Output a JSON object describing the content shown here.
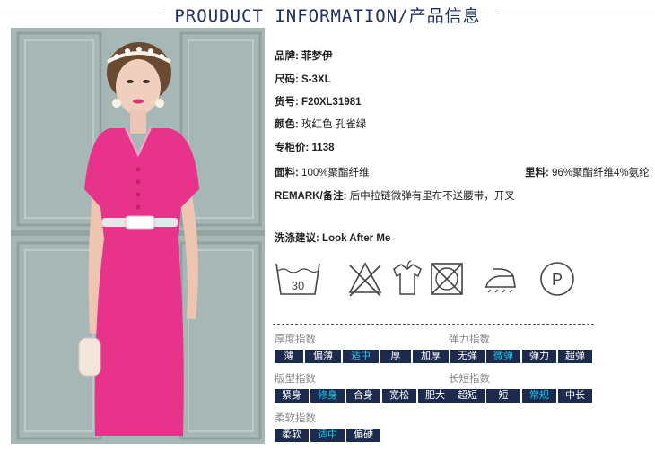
{
  "header": {
    "title": "PROUDUCT INFORMATION/产品信息"
  },
  "info": {
    "brand": {
      "label": "品牌:",
      "value": "菲梦伊"
    },
    "size": {
      "label": "尺码:",
      "value": "S-3XL"
    },
    "sku": {
      "label": "货号:",
      "value": "F20XL31981"
    },
    "color": {
      "label": "颜色:",
      "value": "玫红色 孔雀绿"
    },
    "price": {
      "label": "专柜价:",
      "value": "1138"
    },
    "fabric": {
      "label": "面料:",
      "value": "100%聚酯纤维"
    },
    "lining": {
      "label": "里料:",
      "value": "96%聚酯纤维4%氨纶"
    },
    "remark": {
      "label": "REMARK/备注:",
      "value": "后中拉链微弹有里布不送腰带，开叉"
    },
    "wash": {
      "label": "洗涤建议:",
      "value": "Look After Me"
    }
  },
  "care_icons": [
    {
      "icon": "wash-30-icon",
      "text": "30"
    },
    {
      "icon": "no-bleach-icon"
    },
    {
      "icon": "hang-dry-icon"
    },
    {
      "icon": "no-tumble-dry-icon"
    },
    {
      "icon": "iron-icon"
    },
    {
      "icon": "dry-clean-p-icon",
      "text": "P"
    }
  ],
  "indices": {
    "thickness": {
      "label": "厚度指数",
      "options": [
        "薄",
        "偏薄",
        "适中",
        "厚",
        "加厚"
      ],
      "selected": "适中"
    },
    "elasticity": {
      "label": "弹力指数",
      "options": [
        "无弹",
        "微弹",
        "弹力",
        "超弹"
      ],
      "selected": "微弹"
    },
    "fit": {
      "label": "版型指数",
      "options": [
        "紧身",
        "修身",
        "合身",
        "宽松",
        "肥大"
      ],
      "selected": "修身"
    },
    "length": {
      "label": "长短指数",
      "options": [
        "超短",
        "短",
        "常规",
        "中长"
      ],
      "selected": "常规"
    },
    "softness": {
      "label": "柔软指数",
      "options": [
        "柔软",
        "适中",
        "偏硬"
      ],
      "selected": "适中"
    }
  },
  "colors": {
    "accent": "#16c8f2",
    "chip_bg": "#1c2a4e",
    "dress": "#e8338a",
    "title": "#1f2f5e"
  }
}
